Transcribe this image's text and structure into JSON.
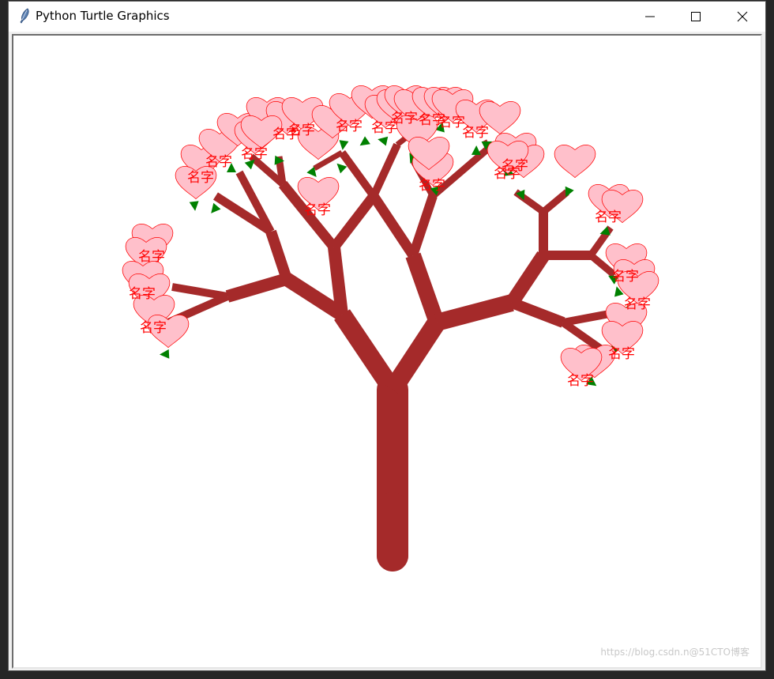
{
  "window": {
    "title": "Python Turtle Graphics",
    "buttons": {
      "minimize": "minimize",
      "maximize": "maximize",
      "close": "close"
    }
  },
  "canvas": {
    "background": "#ffffff",
    "trunk_color": "#a52a2a",
    "leaf_color": "#008000",
    "heart_fill": "#ffc0cb",
    "heart_outline": "#ff0000",
    "heart_label": "名字",
    "label_color": "#ff0000"
  },
  "watermark": "https://blog.csdn.n@51CTO博客"
}
